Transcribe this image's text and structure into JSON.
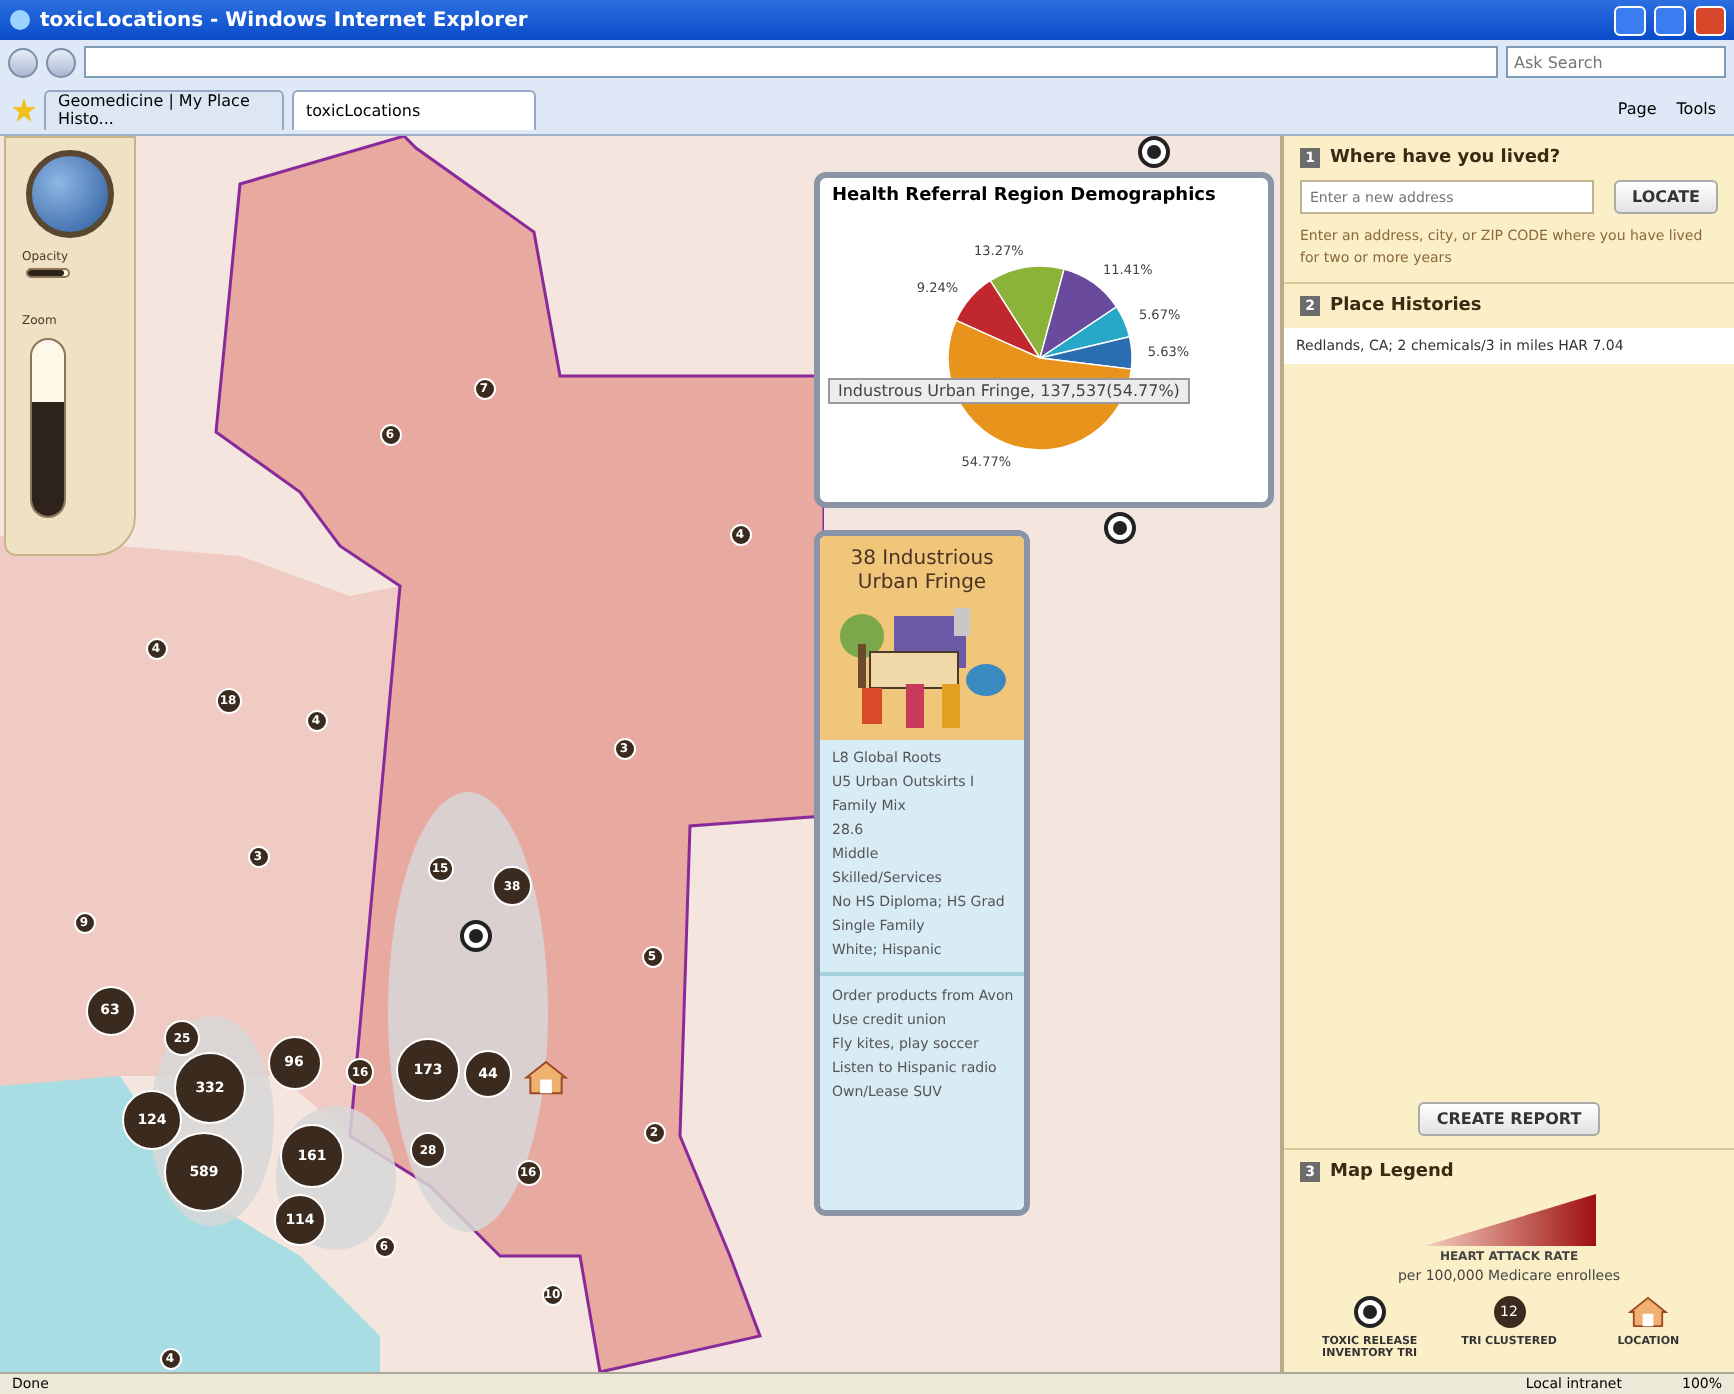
{
  "window": {
    "title": "toxicLocations - Windows Internet Explorer"
  },
  "address_bar": {
    "search_placeholder": "Ask Search"
  },
  "tabs": [
    {
      "label": "Geomedicine | My Place Histo...",
      "selected": false
    },
    {
      "label": "toxicLocations",
      "selected": true
    }
  ],
  "command_bar": [
    "Page",
    "Tools"
  ],
  "map_controls": {
    "opacity_label": "Opacity",
    "opacity_slider": {
      "level": 0.9
    },
    "zoom_label": "Zoom",
    "zoom_slider": {
      "level": 0.65
    }
  },
  "clusters": [
    {
      "label": "7"
    },
    {
      "label": "6"
    },
    {
      "label": "4"
    },
    {
      "label": "4"
    },
    {
      "label": "18"
    },
    {
      "label": "4"
    },
    {
      "label": "3"
    },
    {
      "label": "3"
    },
    {
      "label": "9"
    },
    {
      "label": "15"
    },
    {
      "label": "38"
    },
    {
      "label": "5"
    },
    {
      "label": "63"
    },
    {
      "label": "25"
    },
    {
      "label": "96"
    },
    {
      "label": "16"
    },
    {
      "label": "173"
    },
    {
      "label": "44"
    },
    {
      "label": "332"
    },
    {
      "label": "124"
    },
    {
      "label": "589"
    },
    {
      "label": "161"
    },
    {
      "label": "114"
    },
    {
      "label": "28"
    },
    {
      "label": "16"
    },
    {
      "label": "2"
    },
    {
      "label": "6"
    },
    {
      "label": "10"
    },
    {
      "label": "4"
    }
  ],
  "demographics": {
    "tooltip": "Industrous Urban Fringe, 137,537(54.77%)",
    "chart_data": {
      "type": "pie",
      "title": "Health Referral Region Demographics",
      "values": [
        9.24,
        13.27,
        11.41,
        5.67,
        5.63,
        54.77
      ],
      "value_labels": [
        "9.24%",
        "13.27%",
        "11.41%",
        "5.67%",
        "5.63%",
        "54.77%"
      ]
    }
  },
  "segment": {
    "title": "38 Industrious Urban Fringe",
    "traits": [
      "L8 Global Roots",
      "U5 Urban Outskirts I",
      "Family Mix",
      "28.6",
      "Middle",
      "Skilled/Services",
      "No HS Diploma; HS Grad",
      "Single Family",
      "White; Hispanic"
    ],
    "habits": [
      "Order products from Avon",
      "Use credit union",
      "Fly kites, play soccer",
      "Listen to Hispanic radio",
      "Own/Lease SUV"
    ]
  },
  "sidebar": {
    "step1": {
      "number": "1",
      "title": "Where have you lived?",
      "placeholder": "Enter a new address",
      "button": "LOCATE",
      "hint": "Enter an address, city, or ZIP CODE where you have lived for two or more years"
    },
    "step2": {
      "number": "2",
      "title": "Place Histories",
      "entries": [
        "Redlands, CA; 2 chemicals/3 in miles HAR 7.04"
      ]
    },
    "create_button": "CREATE REPORT",
    "step3": {
      "number": "3",
      "title": "Map Legend",
      "rate_title": "HEART ATTACK RATE",
      "rate_sub": "per 100,000 Medicare enrollees",
      "items": [
        {
          "kind": "tri",
          "label": "TOXIC RELEASE INVENTORY TRI"
        },
        {
          "kind": "cluster",
          "badge": "12",
          "label": "TRI CLUSTERED"
        },
        {
          "kind": "location",
          "label": "LOCATION"
        }
      ]
    }
  },
  "status_bar": {
    "text": "Done",
    "zone": "Local intranet",
    "zoom": "100%"
  }
}
